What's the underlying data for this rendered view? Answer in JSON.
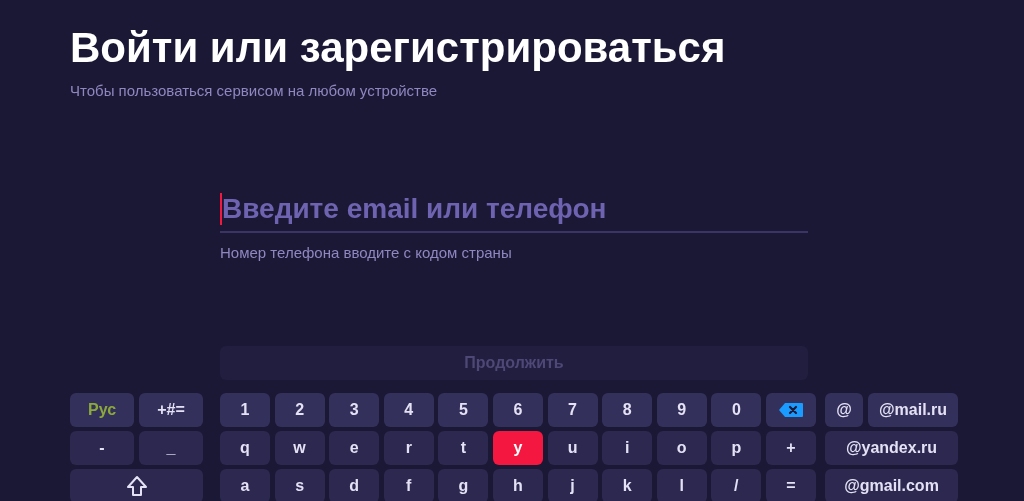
{
  "title": "Войти или зарегистрироваться",
  "subtitle": "Чтобы пользоваться сервисом на любом устройстве",
  "login_field": {
    "placeholder": "Введите email или телефон",
    "focused": true
  },
  "hint": "Номер телефона вводите с кодом страны",
  "continue_button": {
    "label": "Продолжить",
    "disabled": true
  },
  "keyboard": {
    "rows": [
      {
        "left": [
          {
            "kind": "text",
            "label": "Рус",
            "accent": true,
            "selected": false
          },
          {
            "kind": "text",
            "label": "+#=",
            "accent": false,
            "selected": false
          }
        ],
        "main": [
          {
            "kind": "text",
            "label": "1",
            "selected": false
          },
          {
            "kind": "text",
            "label": "2",
            "selected": false
          },
          {
            "kind": "text",
            "label": "3",
            "selected": false
          },
          {
            "kind": "text",
            "label": "4",
            "selected": false
          },
          {
            "kind": "text",
            "label": "5",
            "selected": false
          },
          {
            "kind": "text",
            "label": "6",
            "selected": false
          },
          {
            "kind": "text",
            "label": "7",
            "selected": false
          },
          {
            "kind": "text",
            "label": "8",
            "selected": false
          },
          {
            "kind": "text",
            "label": "9",
            "selected": false
          },
          {
            "kind": "text",
            "label": "0",
            "selected": false
          },
          {
            "kind": "backspace",
            "selected": false
          }
        ],
        "right": [
          {
            "label": "@",
            "selected": false
          },
          {
            "label": "@mail.ru",
            "selected": false
          }
        ]
      },
      {
        "left": [
          {
            "kind": "text",
            "label": "-",
            "accent": false,
            "selected": false
          },
          {
            "kind": "text",
            "label": "_",
            "accent": false,
            "selected": false
          }
        ],
        "main": [
          {
            "kind": "text",
            "label": "q",
            "selected": false
          },
          {
            "kind": "text",
            "label": "w",
            "selected": false
          },
          {
            "kind": "text",
            "label": "e",
            "selected": false
          },
          {
            "kind": "text",
            "label": "r",
            "selected": false
          },
          {
            "kind": "text",
            "label": "t",
            "selected": false
          },
          {
            "kind": "text",
            "label": "y",
            "selected": true
          },
          {
            "kind": "text",
            "label": "u",
            "selected": false
          },
          {
            "kind": "text",
            "label": "i",
            "selected": false
          },
          {
            "kind": "text",
            "label": "o",
            "selected": false
          },
          {
            "kind": "text",
            "label": "p",
            "selected": false
          },
          {
            "kind": "text",
            "label": "+",
            "selected": false
          }
        ],
        "right": [
          {
            "label": "@yandex.ru",
            "selected": false
          }
        ]
      },
      {
        "left": [
          {
            "kind": "shift",
            "selected": false
          }
        ],
        "main": [
          {
            "kind": "text",
            "label": "a",
            "selected": false
          },
          {
            "kind": "text",
            "label": "s",
            "selected": false
          },
          {
            "kind": "text",
            "label": "d",
            "selected": false
          },
          {
            "kind": "text",
            "label": "f",
            "selected": false
          },
          {
            "kind": "text",
            "label": "g",
            "selected": false
          },
          {
            "kind": "text",
            "label": "h",
            "selected": false
          },
          {
            "kind": "text",
            "label": "j",
            "selected": false
          },
          {
            "kind": "text",
            "label": "k",
            "selected": false
          },
          {
            "kind": "text",
            "label": "l",
            "selected": false
          },
          {
            "kind": "text",
            "label": "/",
            "selected": false
          },
          {
            "kind": "text",
            "label": "=",
            "selected": false
          }
        ],
        "right": [
          {
            "label": "@gmail.com",
            "selected": false
          }
        ]
      }
    ]
  }
}
